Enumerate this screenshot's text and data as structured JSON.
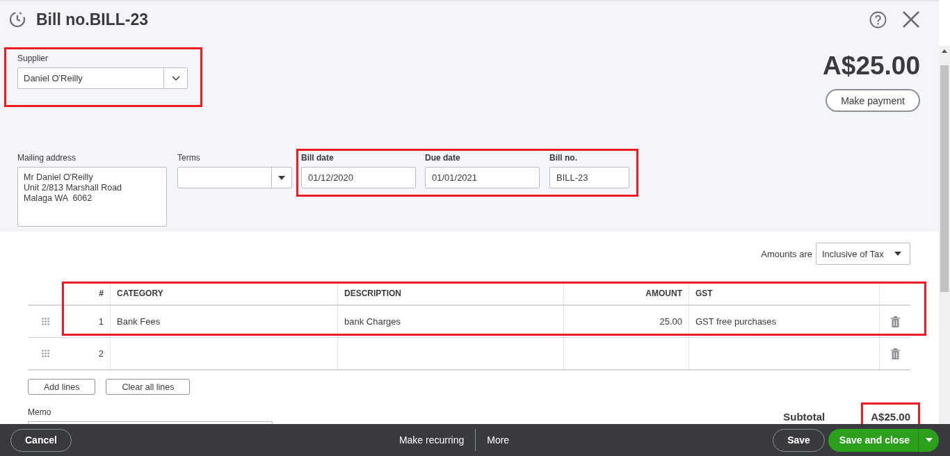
{
  "header": {
    "title": "Bill no.BILL-23"
  },
  "supplier": {
    "label": "Supplier",
    "value": "Daniel O'Reilly"
  },
  "balance": {
    "amount": "A$25.00",
    "button": "Make payment"
  },
  "mailing_address": {
    "label": "Mailing address",
    "lines": [
      "Mr Daniel O'Reilly",
      "Unit 2/813 Marshall Road",
      "Malaga WA  6062"
    ]
  },
  "terms": {
    "label": "Terms"
  },
  "fields": [
    {
      "label": "Bill date",
      "value": "01/12/2020"
    },
    {
      "label": "Due date",
      "value": "01/01/2021"
    },
    {
      "label": "Bill no.",
      "value": "BILL-23"
    }
  ],
  "amounts_are": {
    "label": "Amounts are",
    "value": "Inclusive of Tax"
  },
  "table": {
    "columns": [
      "#",
      "CATEGORY",
      "DESCRIPTION",
      "AMOUNT",
      "GST"
    ],
    "rows": [
      {
        "number": "1",
        "category": "Bank Fees",
        "description": "bank Charges",
        "amount": "25.00",
        "gst": "GST free purchases"
      },
      {
        "number": "2"
      }
    ]
  },
  "line_buttons": [
    "Add lines",
    "Clear all lines"
  ],
  "memo": {
    "label": "Memo"
  },
  "subtotal": {
    "label": "Subtotal",
    "value": "A$25.00"
  },
  "footer": {
    "cancel": "Cancel",
    "center": [
      "Make recurring",
      "More"
    ],
    "save": "Save",
    "save_and_close": "Save and close"
  }
}
